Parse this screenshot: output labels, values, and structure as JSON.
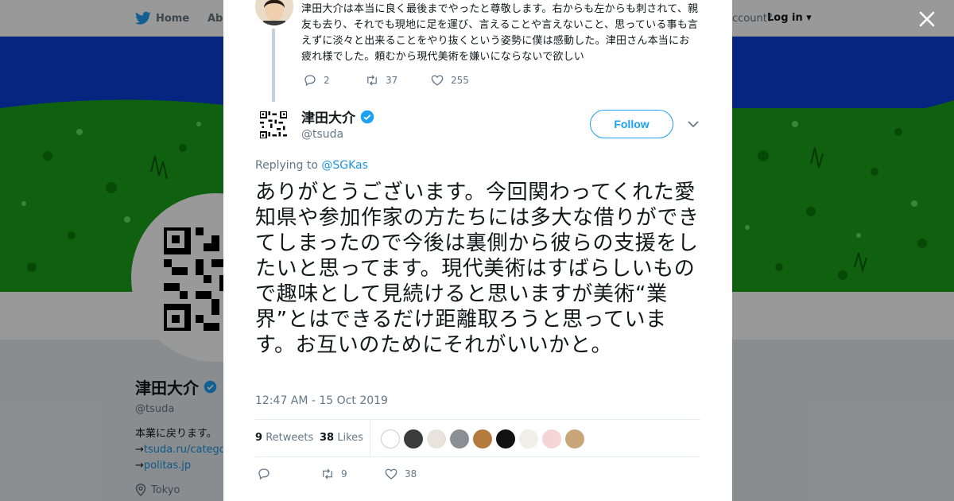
{
  "topbar": {
    "home_label": "Home",
    "about_label": "Abo",
    "account_prompt": "ccount?",
    "login_label": "Log in"
  },
  "profile": {
    "name": "津田大介",
    "handle": "@tsuda",
    "bio_line1": "本業に戻ります。",
    "bio_arrow1": "→",
    "bio_link1": "tsuda.ru/catego",
    "bio_arrow2": "→",
    "bio_link2": "politas.jp",
    "location": "Tokyo"
  },
  "parent_tweet": {
    "text": "津田大介は本当に良く最後までやったと尊敬します。右からも左からも刺されて、親友も去り、それでも現地に足を運び、言えることや言えないこと、思っている事も言えずに淡々と出来ることをやり抜くという姿勢に僕は感動した。津田さん本当にお疲れ様でした。頼むから現代美術を嫌いにならないで欲しい",
    "replies": "2",
    "retweets": "37",
    "likes": "255"
  },
  "tweet": {
    "author_name": "津田大介",
    "author_handle": "@tsuda",
    "follow_label": "Follow",
    "replying_prefix": "Replying to",
    "replying_handle": "@SGKas",
    "text": "ありがとうございます。今回関わってくれた愛知県や参加作家の方たちには多大な借りができてしまったので今後は裏側から彼らの支援をしたいと思ってます。現代美術はすばらしいもので趣味として見続けると思いますが美術“業界”とはできるだけ距離取ろうと思っています。お互いのためにそれがいいかと。",
    "timestamp": "12:47 AM - 15 Oct 2019",
    "retweet_count": "9",
    "retweet_word": "Retweets",
    "like_count": "38",
    "like_word": "Likes",
    "reply_count": "",
    "action_retweets": "9",
    "action_likes": "38"
  },
  "colors": {
    "accent": "#1da1f2",
    "link": "#1b95e0",
    "banner_blue": "#0a3fd8",
    "banner_green": "#1aa01a",
    "muted": "#657786"
  },
  "icons": [
    "twitter-bird-icon",
    "close-icon",
    "verified-badge-icon",
    "reply-icon",
    "retweet-icon",
    "like-icon",
    "chevron-down-icon",
    "location-icon"
  ]
}
